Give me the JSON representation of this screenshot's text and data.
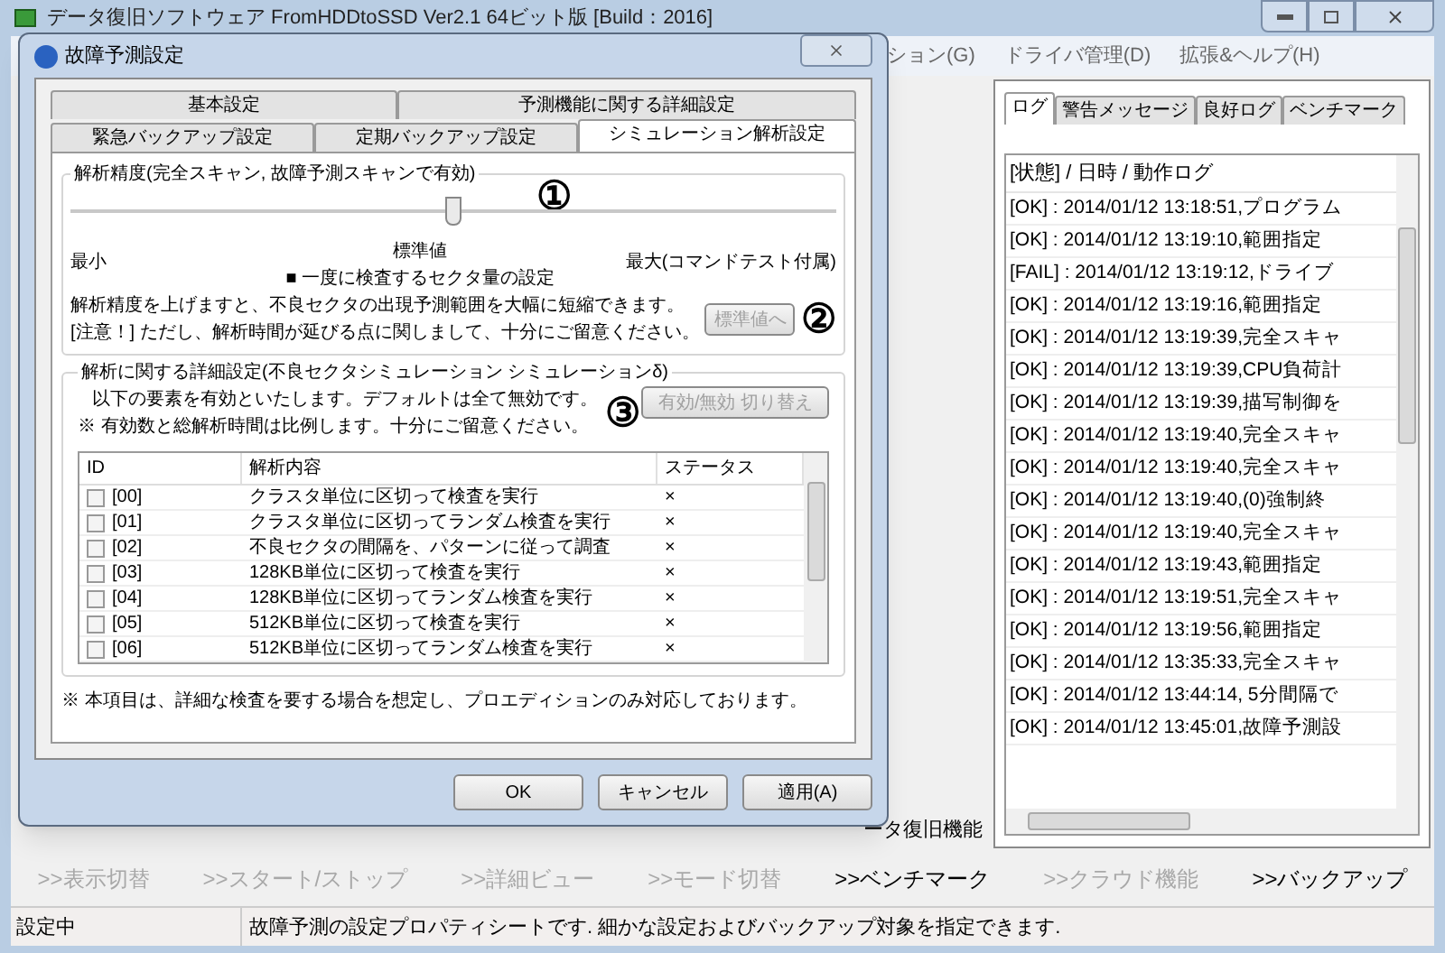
{
  "main_window": {
    "title": "データ復旧ソフトウェア FromHDDtoSSD Ver2.1 64ビット版 [Build：2016]",
    "menu": [
      "ション(G)",
      "ドライバ管理(D)",
      "拡張&ヘルプ(H)"
    ],
    "side_label": "ータ復旧機能",
    "log_tabs": [
      {
        "label": "ログ",
        "selected": true
      },
      {
        "label": "警告メッセージ",
        "selected": false
      },
      {
        "label": "良好ログ",
        "selected": false
      },
      {
        "label": "ベンチマーク",
        "selected": false
      }
    ],
    "log_header": "[状態] / 日時 / 動作ログ",
    "log_rows": [
      "[OK] : 2014/01/12 13:18:51,プログラム",
      "[OK] : 2014/01/12 13:19:10,範囲指定",
      "[FAIL] : 2014/01/12 13:19:12,ドライブ",
      "[OK] : 2014/01/12 13:19:16,範囲指定",
      "[OK] : 2014/01/12 13:19:39,完全スキャ",
      "[OK] : 2014/01/12 13:19:39,CPU負荷計",
      "[OK] : 2014/01/12 13:19:39,描写制御を",
      "[OK] : 2014/01/12 13:19:40,完全スキャ",
      "[OK] : 2014/01/12 13:19:40,完全スキャ",
      "[OK] : 2014/01/12 13:19:40,(0)強制終",
      "[OK] : 2014/01/12 13:19:40,完全スキャ",
      "[OK] : 2014/01/12 13:19:43,範囲指定",
      "[OK] : 2014/01/12 13:19:51,完全スキャ",
      "[OK] : 2014/01/12 13:19:56,範囲指定",
      "[OK] : 2014/01/12 13:35:33,完全スキャ",
      "[OK] : 2014/01/12 13:44:14, 5分間隔で",
      "[OK] : 2014/01/12 13:45:01,故障予測設"
    ],
    "nav": [
      {
        "label": ">>表示切替",
        "disabled": true
      },
      {
        "label": ">>スタート/ストップ",
        "disabled": true
      },
      {
        "label": ">>詳細ビュー",
        "disabled": true
      },
      {
        "label": ">>モード切替",
        "disabled": true
      },
      {
        "label": ">>ベンチマーク",
        "disabled": false
      },
      {
        "label": ">>クラウド機能",
        "disabled": true
      },
      {
        "label": ">>バックアップ",
        "disabled": false
      }
    ],
    "status_bar": {
      "state": "設定中",
      "message": "故障予測の設定プロパティシートです. 細かな設定およびバックアップ対象を指定できます."
    }
  },
  "dialog": {
    "title": "故障予測設定",
    "tab_rows": [
      [
        {
          "label": "基本設定",
          "selected": false
        },
        {
          "label": "予測機能に関する詳細設定",
          "selected": false
        }
      ],
      [
        {
          "label": "緊急バックアップ設定",
          "selected": false
        },
        {
          "label": "定期バックアップ設定",
          "selected": false
        },
        {
          "label": "シミュレーション解析設定",
          "selected": true
        }
      ]
    ],
    "precision": {
      "legend": "解析精度(完全スキャン, 故障予測スキャンで有効)",
      "level": 0.5,
      "min_label": "最小",
      "mid_label": "標準値",
      "max_label": "最大(コマンドテスト付属)",
      "sector_label": "■ 一度に検査するセクタ量の設定",
      "note_1": "解析精度を上げますと、不良セクタの出現予測範囲を大幅に短縮できます。",
      "note_2": "[注意！] ただし、解析時間が延びる点に関しまして、十分にご留意ください。",
      "reset_button": {
        "label": "標準値へ",
        "disabled": true
      }
    },
    "detail": {
      "legend": "解析に関する詳細設定(不良セクタシミュレーション シミュレーションδ)",
      "note_1": "以下の要素を有効といたします。デフォルトは全て無効です。",
      "note_2": "※ 有効数と総解析時間は比例します。十分にご留意ください。",
      "toggle_button": {
        "label": "有効/無効 切り替え",
        "disabled": true
      },
      "columns": [
        "ID",
        "解析内容",
        "ステータス"
      ],
      "rows": [
        {
          "id": "[00]",
          "content": "クラスタ単位に区切って検査を実行",
          "status": "×",
          "checked": false
        },
        {
          "id": "[01]",
          "content": "クラスタ単位に区切ってランダム検査を実行",
          "status": "×",
          "checked": false
        },
        {
          "id": "[02]",
          "content": "不良セクタの間隔を、パターンに従って調査",
          "status": "×",
          "checked": false
        },
        {
          "id": "[03]",
          "content": "128KB単位に区切って検査を実行",
          "status": "×",
          "checked": false
        },
        {
          "id": "[04]",
          "content": "128KB単位に区切ってランダム検査を実行",
          "status": "×",
          "checked": false
        },
        {
          "id": "[05]",
          "content": "512KB単位に区切って検査を実行",
          "status": "×",
          "checked": false
        },
        {
          "id": "[06]",
          "content": "512KB単位に区切ってランダム検査を実行",
          "status": "×",
          "checked": false
        }
      ]
    },
    "footnote": "※ 本項目は、詳細な検査を要する場合を想定し、プロエディションのみ対応しております。",
    "buttons": [
      "OK",
      "キャンセル",
      "適用(A)"
    ]
  },
  "annotations": [
    "①",
    "②",
    "③"
  ]
}
